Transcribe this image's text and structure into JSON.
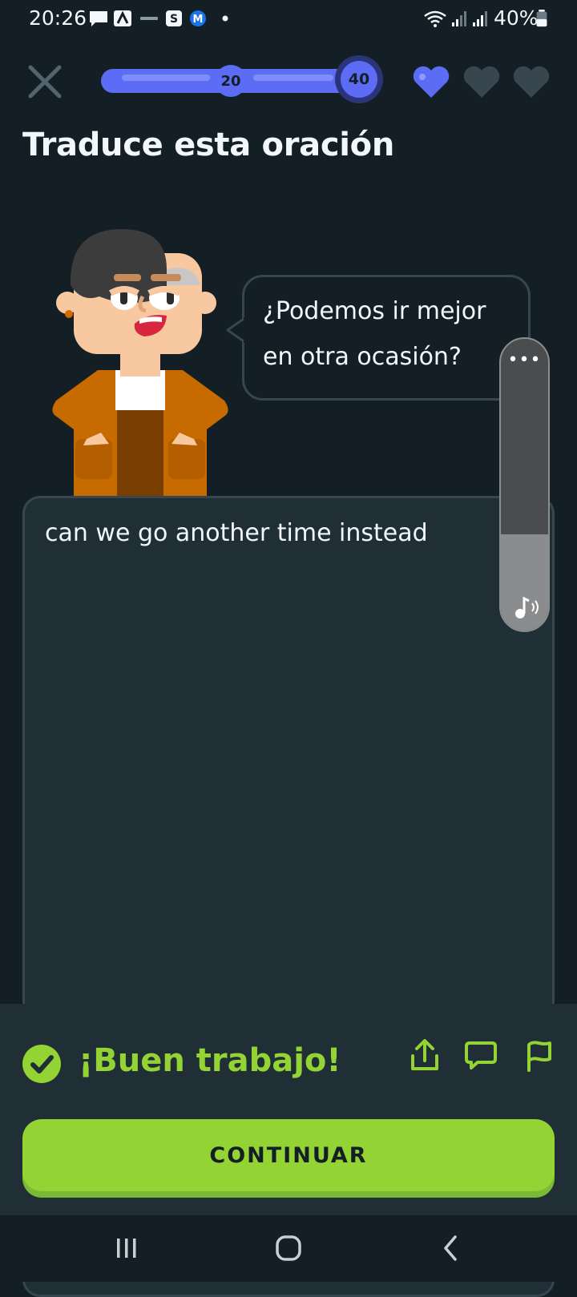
{
  "status_bar": {
    "time": "20:26",
    "battery_percent": "40%"
  },
  "header": {
    "progress": {
      "milestone_1": "20",
      "milestone_2": "40",
      "fill_fraction": 1.0
    },
    "hearts_total": 3,
    "hearts_active": 1,
    "accent_color": "#5c6cf5"
  },
  "title": "Traduce esta oración",
  "prompt": {
    "line_1": "¿Podemos ir mejor",
    "line_2": "en otra ocasión?"
  },
  "answer": {
    "text": "can we go another time instead"
  },
  "volume_overlay": {
    "more_label": "•••",
    "level_fraction": 0.33
  },
  "feedback": {
    "message": "¡Buen trabajo!",
    "color": "#93d333"
  },
  "continue_button": {
    "label": "CONTINUAR"
  },
  "icons": [
    "close-icon",
    "heart-icon",
    "check-circle-icon",
    "share-icon",
    "comment-icon",
    "flag-icon",
    "music-note-icon",
    "nav-recent-icon",
    "nav-home-icon",
    "nav-back-icon"
  ]
}
